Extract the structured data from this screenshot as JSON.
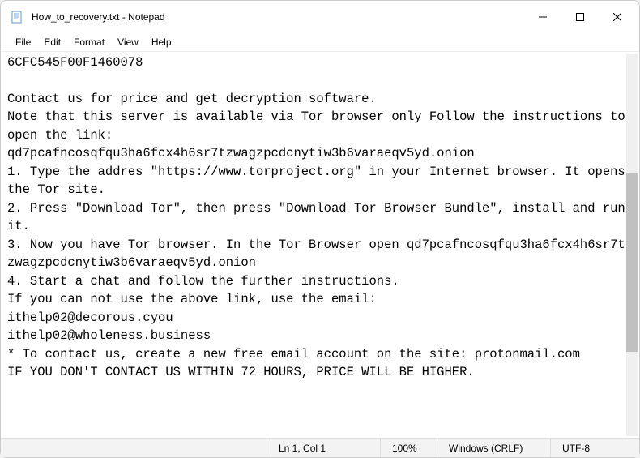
{
  "window": {
    "title": "How_to_recovery.txt - Notepad"
  },
  "menu": {
    "file": "File",
    "edit": "Edit",
    "format": "Format",
    "view": "View",
    "help": "Help"
  },
  "content": {
    "text": "6CFC545F00F1460078\n\nContact us for price and get decryption software.\nNote that this server is available via Tor browser only Follow the instructions to open the link:\nqd7pcafncosqfqu3ha6fcx4h6sr7tzwagzpcdcnytiw3b6varaeqv5yd.onion\n1. Type the addres \"https://www.torproject.org\" in your Internet browser. It opens the Tor site.\n2. Press \"Download Tor\", then press \"Download Tor Browser Bundle\", install and run it.\n3. Now you have Tor browser. In the Tor Browser open qd7pcafncosqfqu3ha6fcx4h6sr7tzwagzpcdcnytiw3b6varaeqv5yd.onion\n4. Start a chat and follow the further instructions.\nIf you can not use the above link, use the email:\nithelp02@decorous.cyou\nithelp02@wholeness.business\n* To contact us, create a new free email account on the site: protonmail.com\nIF YOU DON'T CONTACT US WITHIN 72 HOURS, PRICE WILL BE HIGHER."
  },
  "statusbar": {
    "position": "Ln 1, Col 1",
    "zoom": "100%",
    "line_ending": "Windows (CRLF)",
    "encoding": "UTF-8"
  }
}
